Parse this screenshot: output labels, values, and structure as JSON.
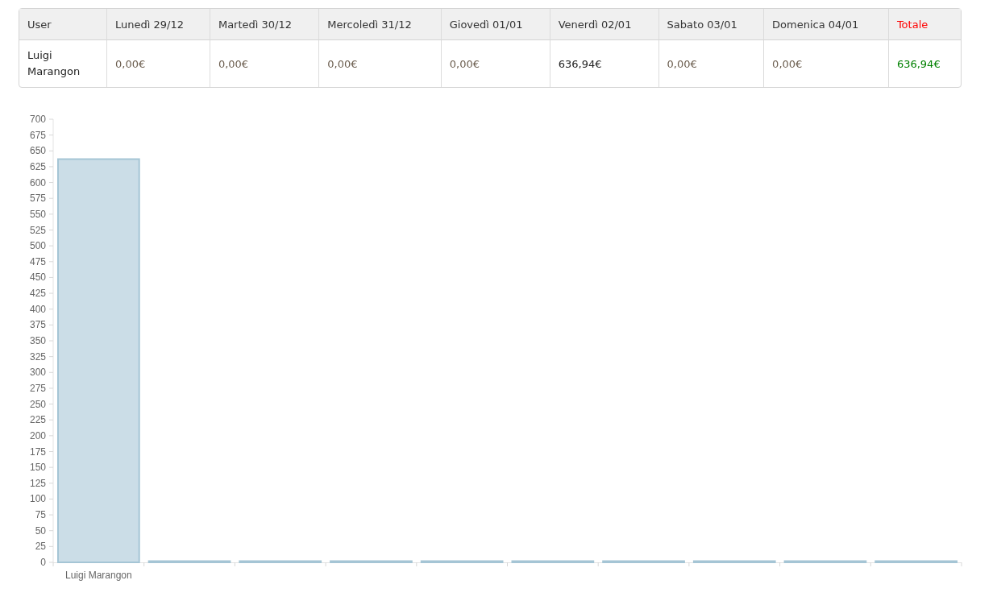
{
  "table": {
    "columns": [
      {
        "label": "User",
        "kind": "plain"
      },
      {
        "label": "Lunedì 29/12",
        "kind": "plain"
      },
      {
        "label": "Martedì 30/12",
        "kind": "plain"
      },
      {
        "label": "Mercoledì 31/12",
        "kind": "plain"
      },
      {
        "label": "Giovedì 01/01",
        "kind": "plain"
      },
      {
        "label": "Venerdì 02/01",
        "kind": "plain"
      },
      {
        "label": "Sabato 03/01",
        "kind": "plain"
      },
      {
        "label": "Domenica 04/01",
        "kind": "plain"
      },
      {
        "label": "Totale",
        "kind": "total"
      }
    ],
    "rows": [
      {
        "cells": [
          {
            "text": "Luigi Marangon",
            "kind": "name"
          },
          {
            "text": "0,00€",
            "kind": "zero"
          },
          {
            "text": "0,00€",
            "kind": "zero"
          },
          {
            "text": "0,00€",
            "kind": "zero"
          },
          {
            "text": "0,00€",
            "kind": "zero"
          },
          {
            "text": "636,94€",
            "kind": "amount"
          },
          {
            "text": "0,00€",
            "kind": "zero"
          },
          {
            "text": "0,00€",
            "kind": "zero"
          },
          {
            "text": "636,94€",
            "kind": "total"
          }
        ]
      }
    ]
  },
  "chart": {
    "chart_data": {
      "type": "bar",
      "categories": [
        "Luigi Marangon",
        null,
        null,
        null,
        null,
        null,
        null,
        null,
        null,
        null
      ],
      "series": [
        {
          "color": "#cbdde7",
          "values": [
            637,
            0,
            0,
            0,
            0,
            0,
            0,
            0,
            0,
            0
          ]
        }
      ],
      "ylim": [
        0,
        700
      ],
      "yticks": [
        0,
        25,
        50,
        75,
        100,
        125,
        150,
        175,
        200,
        225,
        250,
        275,
        300,
        325,
        350,
        375,
        400,
        425,
        450,
        475,
        500,
        525,
        550,
        575,
        600,
        625,
        650,
        675,
        700
      ]
    }
  }
}
